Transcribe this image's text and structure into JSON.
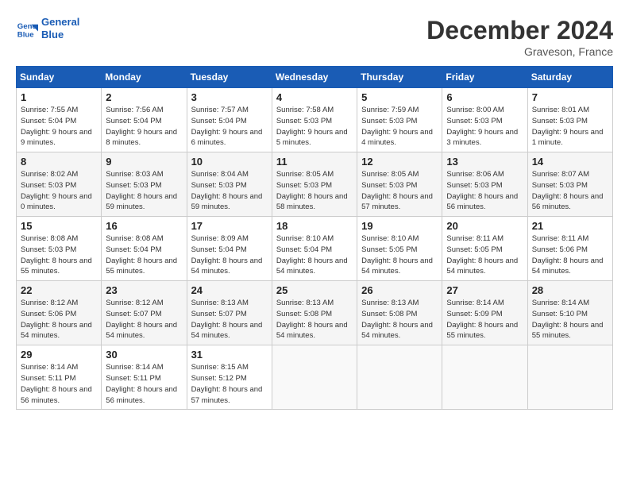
{
  "header": {
    "logo_line1": "General",
    "logo_line2": "Blue",
    "month": "December 2024",
    "location": "Graveson, France"
  },
  "weekdays": [
    "Sunday",
    "Monday",
    "Tuesday",
    "Wednesday",
    "Thursday",
    "Friday",
    "Saturday"
  ],
  "days": [
    {
      "num": "1",
      "sunrise": "7:55 AM",
      "sunset": "5:04 PM",
      "daylight": "9 hours and 9 minutes."
    },
    {
      "num": "2",
      "sunrise": "7:56 AM",
      "sunset": "5:04 PM",
      "daylight": "9 hours and 8 minutes."
    },
    {
      "num": "3",
      "sunrise": "7:57 AM",
      "sunset": "5:04 PM",
      "daylight": "9 hours and 6 minutes."
    },
    {
      "num": "4",
      "sunrise": "7:58 AM",
      "sunset": "5:03 PM",
      "daylight": "9 hours and 5 minutes."
    },
    {
      "num": "5",
      "sunrise": "7:59 AM",
      "sunset": "5:03 PM",
      "daylight": "9 hours and 4 minutes."
    },
    {
      "num": "6",
      "sunrise": "8:00 AM",
      "sunset": "5:03 PM",
      "daylight": "9 hours and 3 minutes."
    },
    {
      "num": "7",
      "sunrise": "8:01 AM",
      "sunset": "5:03 PM",
      "daylight": "9 hours and 1 minute."
    },
    {
      "num": "8",
      "sunrise": "8:02 AM",
      "sunset": "5:03 PM",
      "daylight": "9 hours and 0 minutes."
    },
    {
      "num": "9",
      "sunrise": "8:03 AM",
      "sunset": "5:03 PM",
      "daylight": "8 hours and 59 minutes."
    },
    {
      "num": "10",
      "sunrise": "8:04 AM",
      "sunset": "5:03 PM",
      "daylight": "8 hours and 59 minutes."
    },
    {
      "num": "11",
      "sunrise": "8:05 AM",
      "sunset": "5:03 PM",
      "daylight": "8 hours and 58 minutes."
    },
    {
      "num": "12",
      "sunrise": "8:05 AM",
      "sunset": "5:03 PM",
      "daylight": "8 hours and 57 minutes."
    },
    {
      "num": "13",
      "sunrise": "8:06 AM",
      "sunset": "5:03 PM",
      "daylight": "8 hours and 56 minutes."
    },
    {
      "num": "14",
      "sunrise": "8:07 AM",
      "sunset": "5:03 PM",
      "daylight": "8 hours and 56 minutes."
    },
    {
      "num": "15",
      "sunrise": "8:08 AM",
      "sunset": "5:03 PM",
      "daylight": "8 hours and 55 minutes."
    },
    {
      "num": "16",
      "sunrise": "8:08 AM",
      "sunset": "5:04 PM",
      "daylight": "8 hours and 55 minutes."
    },
    {
      "num": "17",
      "sunrise": "8:09 AM",
      "sunset": "5:04 PM",
      "daylight": "8 hours and 54 minutes."
    },
    {
      "num": "18",
      "sunrise": "8:10 AM",
      "sunset": "5:04 PM",
      "daylight": "8 hours and 54 minutes."
    },
    {
      "num": "19",
      "sunrise": "8:10 AM",
      "sunset": "5:05 PM",
      "daylight": "8 hours and 54 minutes."
    },
    {
      "num": "20",
      "sunrise": "8:11 AM",
      "sunset": "5:05 PM",
      "daylight": "8 hours and 54 minutes."
    },
    {
      "num": "21",
      "sunrise": "8:11 AM",
      "sunset": "5:06 PM",
      "daylight": "8 hours and 54 minutes."
    },
    {
      "num": "22",
      "sunrise": "8:12 AM",
      "sunset": "5:06 PM",
      "daylight": "8 hours and 54 minutes."
    },
    {
      "num": "23",
      "sunrise": "8:12 AM",
      "sunset": "5:07 PM",
      "daylight": "8 hours and 54 minutes."
    },
    {
      "num": "24",
      "sunrise": "8:13 AM",
      "sunset": "5:07 PM",
      "daylight": "8 hours and 54 minutes."
    },
    {
      "num": "25",
      "sunrise": "8:13 AM",
      "sunset": "5:08 PM",
      "daylight": "8 hours and 54 minutes."
    },
    {
      "num": "26",
      "sunrise": "8:13 AM",
      "sunset": "5:08 PM",
      "daylight": "8 hours and 54 minutes."
    },
    {
      "num": "27",
      "sunrise": "8:14 AM",
      "sunset": "5:09 PM",
      "daylight": "8 hours and 55 minutes."
    },
    {
      "num": "28",
      "sunrise": "8:14 AM",
      "sunset": "5:10 PM",
      "daylight": "8 hours and 55 minutes."
    },
    {
      "num": "29",
      "sunrise": "8:14 AM",
      "sunset": "5:11 PM",
      "daylight": "8 hours and 56 minutes."
    },
    {
      "num": "30",
      "sunrise": "8:14 AM",
      "sunset": "5:11 PM",
      "daylight": "8 hours and 56 minutes."
    },
    {
      "num": "31",
      "sunrise": "8:15 AM",
      "sunset": "5:12 PM",
      "daylight": "8 hours and 57 minutes."
    }
  ]
}
